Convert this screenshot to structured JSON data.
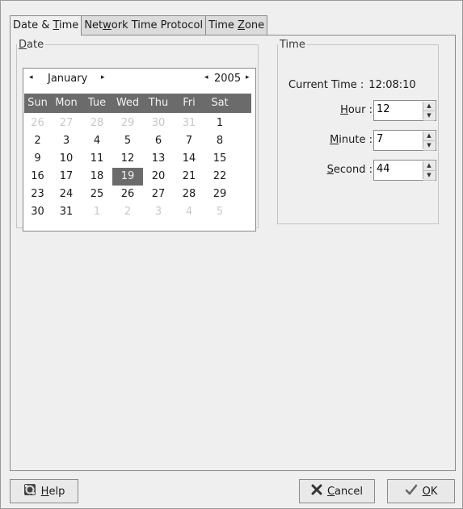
{
  "tabs": [
    {
      "pre": "Date & ",
      "key": "T",
      "post": "ime"
    },
    {
      "pre": "Net",
      "key": "w",
      "post": "ork Time Protocol"
    },
    {
      "pre": "Time ",
      "key": "Z",
      "post": "one"
    }
  ],
  "date_group": {
    "legend_key": "D",
    "legend_rest": "ate",
    "month_key": "J",
    "month_rest": "anuary",
    "year": "2005",
    "prev_arrow": "◂",
    "next_arrow": "▸",
    "weekdays": [
      "Sun",
      "Mon",
      "Tue",
      "Wed",
      "Thu",
      "Fri",
      "Sat"
    ],
    "days": [
      {
        "d": "26",
        "o": true
      },
      {
        "d": "27",
        "o": true
      },
      {
        "d": "28",
        "o": true
      },
      {
        "d": "29",
        "o": true
      },
      {
        "d": "30",
        "o": true
      },
      {
        "d": "31",
        "o": true
      },
      {
        "d": "1",
        "o": false
      },
      {
        "d": "2",
        "o": false
      },
      {
        "d": "3",
        "o": false
      },
      {
        "d": "4",
        "o": false
      },
      {
        "d": "5",
        "o": false
      },
      {
        "d": "6",
        "o": false
      },
      {
        "d": "7",
        "o": false
      },
      {
        "d": "8",
        "o": false
      },
      {
        "d": "9",
        "o": false
      },
      {
        "d": "10",
        "o": false
      },
      {
        "d": "11",
        "o": false
      },
      {
        "d": "12",
        "o": false
      },
      {
        "d": "13",
        "o": false
      },
      {
        "d": "14",
        "o": false
      },
      {
        "d": "15",
        "o": false
      },
      {
        "d": "16",
        "o": false
      },
      {
        "d": "17",
        "o": false
      },
      {
        "d": "18",
        "o": false
      },
      {
        "d": "19",
        "o": false,
        "sel": true
      },
      {
        "d": "20",
        "o": false
      },
      {
        "d": "21",
        "o": false
      },
      {
        "d": "22",
        "o": false
      },
      {
        "d": "23",
        "o": false
      },
      {
        "d": "24",
        "o": false
      },
      {
        "d": "25",
        "o": false
      },
      {
        "d": "26",
        "o": false
      },
      {
        "d": "27",
        "o": false
      },
      {
        "d": "28",
        "o": false
      },
      {
        "d": "29",
        "o": false
      },
      {
        "d": "30",
        "o": false
      },
      {
        "d": "31",
        "o": false
      },
      {
        "d": "1",
        "o": true
      },
      {
        "d": "2",
        "o": true
      },
      {
        "d": "3",
        "o": true
      },
      {
        "d": "4",
        "o": true
      },
      {
        "d": "5",
        "o": true
      }
    ]
  },
  "time_group": {
    "legend": "Time",
    "current_time_label": "Current Time :",
    "current_time_value": "12:08:10",
    "hour": {
      "key": "H",
      "rest": "our",
      "colon": ":",
      "value": "12"
    },
    "minute": {
      "key": "M",
      "rest": "inute",
      "colon": ":",
      "value": "7"
    },
    "second": {
      "key": "S",
      "rest": "econd",
      "colon": ":",
      "value": "44"
    }
  },
  "buttons": {
    "help": {
      "key": "H",
      "rest": "elp"
    },
    "cancel": {
      "key": "C",
      "rest": "ancel"
    },
    "ok": {
      "key": "O",
      "rest": "K"
    }
  },
  "icons": {
    "help": "lifebuoy-icon",
    "cancel": "x-icon",
    "ok": "checkmark-icon"
  }
}
